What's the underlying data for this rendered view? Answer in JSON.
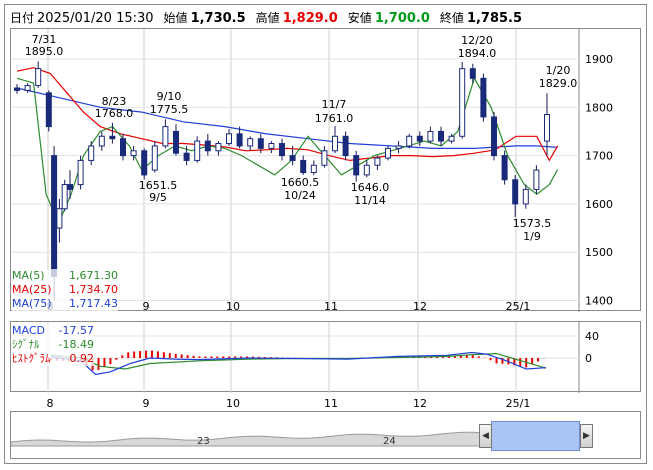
{
  "header": {
    "date_label": "日付",
    "datetime": "2025/01/20 15:30",
    "open_label": "始値",
    "open": "1,730.5",
    "high_label": "高値",
    "high": "1,829.0",
    "low_label": "安値",
    "low": "1,700.0",
    "close_label": "終値",
    "close": "1,785.5",
    "colors": {
      "high": "#e60000",
      "low": "#009a1a"
    }
  },
  "price_chart": {
    "y_ticks": [
      "1900",
      "1800",
      "1700",
      "1600",
      "1500",
      "1400"
    ],
    "x_labels": [
      "8",
      "9",
      "10",
      "11",
      "12",
      "25/1"
    ],
    "annotations": [
      {
        "date": "7/31",
        "value": "1895.0"
      },
      {
        "date": "8/23",
        "value": "1768.0"
      },
      {
        "date": "9/10",
        "value": "1775.5"
      },
      {
        "date": "9/5",
        "value": "1651.5"
      },
      {
        "date": "10/24",
        "value": "1660.5"
      },
      {
        "date": "11/7",
        "value": "1761.0"
      },
      {
        "date": "11/14",
        "value": "1646.0"
      },
      {
        "date": "12/20",
        "value": "1894.0"
      },
      {
        "date": "1/9",
        "value": "1573.5"
      },
      {
        "date": "1/20",
        "value": "1829.0"
      }
    ],
    "legend": [
      {
        "name": "MA(5)",
        "value": "1,671.30",
        "color": "#2e8b2e"
      },
      {
        "name": "MA(25)",
        "value": "1,734.70",
        "color": "#e60000"
      },
      {
        "name": "MA(75)",
        "value": "1,717.43",
        "color": "#1f3fd8"
      }
    ],
    "ma25_points": [
      [
        0,
        1875
      ],
      [
        4,
        1882
      ],
      [
        8,
        1870
      ],
      [
        12,
        1830
      ],
      [
        16,
        1790
      ],
      [
        20,
        1760
      ],
      [
        25,
        1745
      ],
      [
        30,
        1735
      ],
      [
        35,
        1725
      ],
      [
        40,
        1725
      ],
      [
        45,
        1722
      ],
      [
        50,
        1718
      ],
      [
        55,
        1710
      ],
      [
        60,
        1712
      ],
      [
        65,
        1715
      ],
      [
        70,
        1712
      ],
      [
        75,
        1700
      ],
      [
        80,
        1690
      ],
      [
        85,
        1695
      ],
      [
        90,
        1700
      ],
      [
        95,
        1700
      ],
      [
        100,
        1698
      ],
      [
        105,
        1700
      ],
      [
        110,
        1705
      ],
      [
        115,
        1712
      ],
      [
        120,
        1740
      ],
      [
        125,
        1740
      ],
      [
        128,
        1690
      ],
      [
        130,
        1720
      ]
    ],
    "ma75_points": [
      [
        0,
        1840
      ],
      [
        10,
        1820
      ],
      [
        20,
        1800
      ],
      [
        30,
        1790
      ],
      [
        40,
        1770
      ],
      [
        50,
        1760
      ],
      [
        60,
        1745
      ],
      [
        70,
        1735
      ],
      [
        80,
        1725
      ],
      [
        90,
        1720
      ],
      [
        100,
        1715
      ],
      [
        110,
        1715
      ],
      [
        120,
        1720
      ],
      [
        125,
        1720
      ],
      [
        130,
        1717
      ]
    ],
    "ma5_points": [
      [
        0,
        1860
      ],
      [
        4,
        1850
      ],
      [
        7,
        1620
      ],
      [
        10,
        1560
      ],
      [
        13,
        1620
      ],
      [
        16,
        1700
      ],
      [
        20,
        1750
      ],
      [
        23,
        1760
      ],
      [
        27,
        1720
      ],
      [
        30,
        1670
      ],
      [
        34,
        1700
      ],
      [
        38,
        1720
      ],
      [
        42,
        1710
      ],
      [
        46,
        1720
      ],
      [
        50,
        1715
      ],
      [
        54,
        1700
      ],
      [
        58,
        1680
      ],
      [
        62,
        1660
      ],
      [
        66,
        1690
      ],
      [
        70,
        1740
      ],
      [
        74,
        1700
      ],
      [
        78,
        1660
      ],
      [
        82,
        1680
      ],
      [
        86,
        1700
      ],
      [
        90,
        1710
      ],
      [
        94,
        1720
      ],
      [
        98,
        1730
      ],
      [
        102,
        1720
      ],
      [
        106,
        1750
      ],
      [
        110,
        1860
      ],
      [
        114,
        1800
      ],
      [
        118,
        1700
      ],
      [
        122,
        1640
      ],
      [
        125,
        1620
      ],
      [
        128,
        1640
      ],
      [
        130,
        1671
      ]
    ],
    "candles": [
      {
        "i": 0,
        "o": 1840,
        "h": 1848,
        "c": 1835,
        "l": 1828
      },
      {
        "i": 2,
        "o": 1835,
        "h": 1850,
        "c": 1845,
        "l": 1830
      },
      {
        "i": 4,
        "o": 1845,
        "h": 1895,
        "c": 1880,
        "l": 1840
      },
      {
        "i": 6,
        "o": 1830,
        "h": 1835,
        "c": 1760,
        "l": 1750
      },
      {
        "i": 7,
        "o": 1700,
        "h": 1720,
        "c": 1450,
        "l": 1400
      },
      {
        "i": 8,
        "o": 1550,
        "h": 1610,
        "c": 1590,
        "l": 1520
      },
      {
        "i": 9,
        "o": 1590,
        "h": 1650,
        "c": 1640,
        "l": 1585
      },
      {
        "i": 10,
        "o": 1640,
        "h": 1670,
        "c": 1630,
        "l": 1610
      },
      {
        "i": 12,
        "o": 1640,
        "h": 1700,
        "c": 1690,
        "l": 1630
      },
      {
        "i": 14,
        "o": 1690,
        "h": 1730,
        "c": 1720,
        "l": 1680
      },
      {
        "i": 16,
        "o": 1720,
        "h": 1750,
        "c": 1740,
        "l": 1710
      },
      {
        "i": 18,
        "o": 1740,
        "h": 1768,
        "c": 1735,
        "l": 1725
      },
      {
        "i": 20,
        "o": 1735,
        "h": 1745,
        "c": 1700,
        "l": 1690
      },
      {
        "i": 22,
        "o": 1700,
        "h": 1720,
        "c": 1710,
        "l": 1690
      },
      {
        "i": 24,
        "o": 1710,
        "h": 1715,
        "c": 1660,
        "l": 1651
      },
      {
        "i": 26,
        "o": 1670,
        "h": 1730,
        "c": 1720,
        "l": 1665
      },
      {
        "i": 28,
        "o": 1720,
        "h": 1775,
        "c": 1760,
        "l": 1715
      },
      {
        "i": 30,
        "o": 1750,
        "h": 1765,
        "c": 1705,
        "l": 1700
      },
      {
        "i": 32,
        "o": 1705,
        "h": 1720,
        "c": 1690,
        "l": 1680
      },
      {
        "i": 34,
        "o": 1690,
        "h": 1740,
        "c": 1730,
        "l": 1685
      },
      {
        "i": 36,
        "o": 1730,
        "h": 1745,
        "c": 1710,
        "l": 1700
      },
      {
        "i": 38,
        "o": 1710,
        "h": 1730,
        "c": 1725,
        "l": 1700
      },
      {
        "i": 40,
        "o": 1725,
        "h": 1755,
        "c": 1745,
        "l": 1720
      },
      {
        "i": 42,
        "o": 1745,
        "h": 1760,
        "c": 1720,
        "l": 1715
      },
      {
        "i": 44,
        "o": 1720,
        "h": 1740,
        "c": 1735,
        "l": 1710
      },
      {
        "i": 46,
        "o": 1735,
        "h": 1745,
        "c": 1715,
        "l": 1705
      },
      {
        "i": 48,
        "o": 1715,
        "h": 1730,
        "c": 1725,
        "l": 1705
      },
      {
        "i": 50,
        "o": 1725,
        "h": 1735,
        "c": 1700,
        "l": 1690
      },
      {
        "i": 52,
        "o": 1700,
        "h": 1720,
        "c": 1690,
        "l": 1680
      },
      {
        "i": 54,
        "o": 1690,
        "h": 1700,
        "c": 1665,
        "l": 1660
      },
      {
        "i": 56,
        "o": 1665,
        "h": 1690,
        "c": 1680,
        "l": 1660
      },
      {
        "i": 58,
        "o": 1680,
        "h": 1720,
        "c": 1710,
        "l": 1675
      },
      {
        "i": 60,
        "o": 1710,
        "h": 1761,
        "c": 1740,
        "l": 1705
      },
      {
        "i": 62,
        "o": 1740,
        "h": 1750,
        "c": 1700,
        "l": 1690
      },
      {
        "i": 64,
        "o": 1700,
        "h": 1710,
        "c": 1660,
        "l": 1646
      },
      {
        "i": 66,
        "o": 1660,
        "h": 1690,
        "c": 1680,
        "l": 1655
      },
      {
        "i": 68,
        "o": 1680,
        "h": 1700,
        "c": 1695,
        "l": 1670
      },
      {
        "i": 70,
        "o": 1695,
        "h": 1720,
        "c": 1715,
        "l": 1690
      },
      {
        "i": 72,
        "o": 1715,
        "h": 1730,
        "c": 1720,
        "l": 1705
      },
      {
        "i": 74,
        "o": 1720,
        "h": 1745,
        "c": 1740,
        "l": 1715
      },
      {
        "i": 76,
        "o": 1740,
        "h": 1750,
        "c": 1730,
        "l": 1720
      },
      {
        "i": 78,
        "o": 1730,
        "h": 1760,
        "c": 1750,
        "l": 1725
      },
      {
        "i": 80,
        "o": 1750,
        "h": 1760,
        "c": 1730,
        "l": 1720
      },
      {
        "i": 82,
        "o": 1730,
        "h": 1745,
        "c": 1740,
        "l": 1725
      },
      {
        "i": 84,
        "o": 1740,
        "h": 1894,
        "c": 1880,
        "l": 1735
      },
      {
        "i": 86,
        "o": 1880,
        "h": 1890,
        "c": 1860,
        "l": 1850
      },
      {
        "i": 88,
        "o": 1860,
        "h": 1870,
        "c": 1780,
        "l": 1770
      },
      {
        "i": 90,
        "o": 1780,
        "h": 1790,
        "c": 1700,
        "l": 1690
      },
      {
        "i": 92,
        "o": 1700,
        "h": 1710,
        "c": 1650,
        "l": 1640
      },
      {
        "i": 94,
        "o": 1650,
        "h": 1660,
        "c": 1600,
        "l": 1573
      },
      {
        "i": 96,
        "o": 1600,
        "h": 1640,
        "c": 1630,
        "l": 1590
      },
      {
        "i": 98,
        "o": 1630,
        "h": 1680,
        "c": 1670,
        "l": 1620
      },
      {
        "i": 100,
        "o": 1730,
        "h": 1829,
        "c": 1785,
        "l": 1700
      }
    ]
  },
  "macd_chart": {
    "y_ticks": [
      "40",
      "0"
    ],
    "x_labels": [
      "8",
      "9",
      "10",
      "11",
      "12",
      "25/1"
    ],
    "legend": [
      {
        "name": "MACD",
        "value": "-17.57",
        "color": "#1f3fd8"
      },
      {
        "name": "ｼｸﾞﾅﾙ",
        "value": "-18.49",
        "color": "#2e8b2e"
      },
      {
        "name": "ﾋｽﾄｸﾞﾗﾑ",
        "value": "0.92",
        "color": "#e60000"
      }
    ],
    "macd_points": [
      [
        0,
        2
      ],
      [
        6,
        -5
      ],
      [
        9,
        -30
      ],
      [
        12,
        -25
      ],
      [
        16,
        -10
      ],
      [
        20,
        0
      ],
      [
        25,
        -2
      ],
      [
        30,
        -3
      ],
      [
        40,
        0
      ],
      [
        50,
        -1
      ],
      [
        60,
        -2
      ],
      [
        70,
        3
      ],
      [
        80,
        5
      ],
      [
        85,
        10
      ],
      [
        88,
        7
      ],
      [
        92,
        -5
      ],
      [
        96,
        -20
      ],
      [
        100,
        -17.57
      ]
    ],
    "signal_points": [
      [
        0,
        5
      ],
      [
        6,
        0
      ],
      [
        10,
        -15
      ],
      [
        15,
        -20
      ],
      [
        20,
        -10
      ],
      [
        30,
        -5
      ],
      [
        40,
        -2
      ],
      [
        50,
        -1
      ],
      [
        60,
        -1
      ],
      [
        70,
        1
      ],
      [
        80,
        3
      ],
      [
        85,
        6
      ],
      [
        90,
        8
      ],
      [
        95,
        -5
      ],
      [
        100,
        -18.49
      ]
    ]
  },
  "navigator": {
    "labels": [
      "23",
      "24"
    ]
  }
}
